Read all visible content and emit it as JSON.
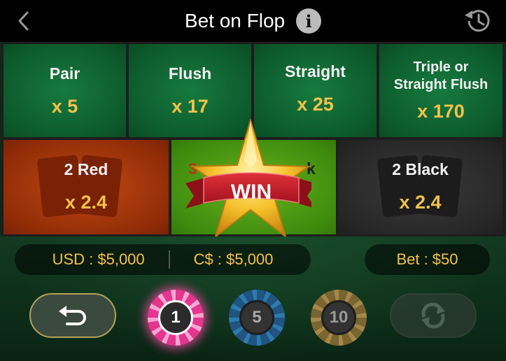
{
  "header": {
    "title": "Bet on Flop",
    "info_label": "i"
  },
  "bets": [
    {
      "label": "Pair",
      "payout": "x 5"
    },
    {
      "label": "Flush",
      "payout": "x 17"
    },
    {
      "label": "Straight",
      "payout": "x 25"
    },
    {
      "label": "Triple or Straight Flush",
      "label_line1": "Triple or",
      "label_line2": "Straight Flush",
      "payout": "x 170"
    }
  ],
  "color_bets": [
    {
      "label": "2 Red",
      "payout": "x 2.4"
    },
    {
      "label_partial_left": "3",
      "label_partial_right": "k"
    },
    {
      "label": "2 Black",
      "payout": "x 2.4"
    }
  ],
  "win_badge": {
    "text": "WIN"
  },
  "balances": {
    "usd": "USD : $5,000",
    "cad": "C$ : $5,000"
  },
  "bet": {
    "label": "Bet : $50"
  },
  "chips": [
    {
      "value": "1",
      "selected": true,
      "color": "#e4358f"
    },
    {
      "value": "5",
      "selected": false,
      "color": "#1f5580"
    },
    {
      "value": "10",
      "selected": false,
      "color": "#7a6530"
    }
  ],
  "colors": {
    "accent_gold": "#f5c24a",
    "felt_green": "#0d5a2c"
  },
  "icons": {
    "back": "chevron-left-icon",
    "info": "info-icon",
    "history": "history-icon",
    "undo": "undo-arrow-icon",
    "rebet": "repeat-icon"
  }
}
